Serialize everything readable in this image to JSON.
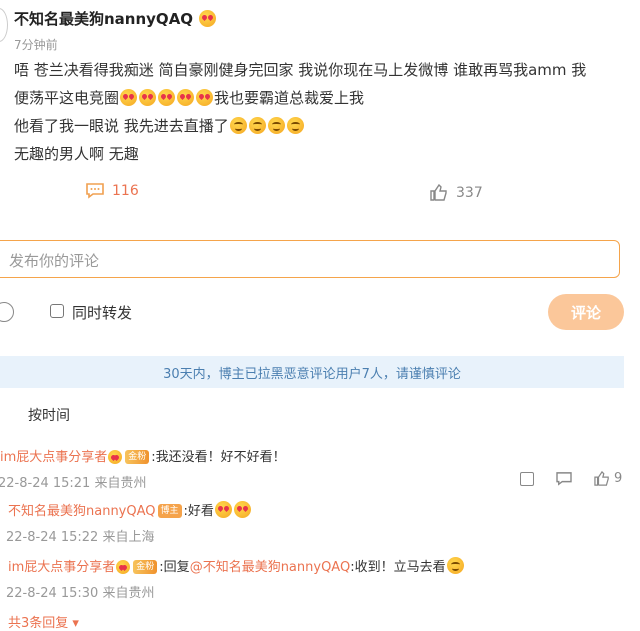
{
  "post": {
    "author": "不知名最美狗nannyQAQ",
    "time": "7分钟前",
    "line1": "唔  苍兰决看得我痴迷  简自豪刚健身完回家  我说你现在马上发微博  谁敢再骂我amm  我",
    "line2a": "便荡平这电竞圈",
    "line2b": "我也要霸道总裁爱上我",
    "line3": "他看了我一眼说  我先进去直播了",
    "line4": "无趣的男人啊  无趣",
    "comment_count": "116",
    "like_count": "337"
  },
  "composer": {
    "placeholder": "发布你的评论",
    "repost_label": "同时转发",
    "submit_label": "评论"
  },
  "notice": "30天内，博主已拉黑恶意评论用户7人，请谨慎评论",
  "sort_label": "按时间",
  "comments": [
    {
      "author": "im屁大点事分享者",
      "badge": "金粉",
      "text": ":我还没看！好不好看！",
      "meta": "22-8-24 15:21 来自贵州",
      "likes": "9"
    }
  ],
  "replies": [
    {
      "author": "不知名最美狗nannyQAQ",
      "badge": "博主",
      "text": ":好看",
      "meta": "22-8-24 15:22 来自上海"
    },
    {
      "author": "im屁大点事分享者",
      "badge": "金粉",
      "text_prefix": ":回复",
      "mention": "@不知名最美狗nannyQAQ",
      "text_suffix": ":收到！立马去看",
      "meta": "22-8-24 15:30 来自贵州"
    }
  ],
  "more_replies": "共3条回复",
  "icons": [
    "love-emoji",
    "smile-emoji",
    "comment-icon",
    "like-icon",
    "smiley-icon",
    "share-icon"
  ]
}
